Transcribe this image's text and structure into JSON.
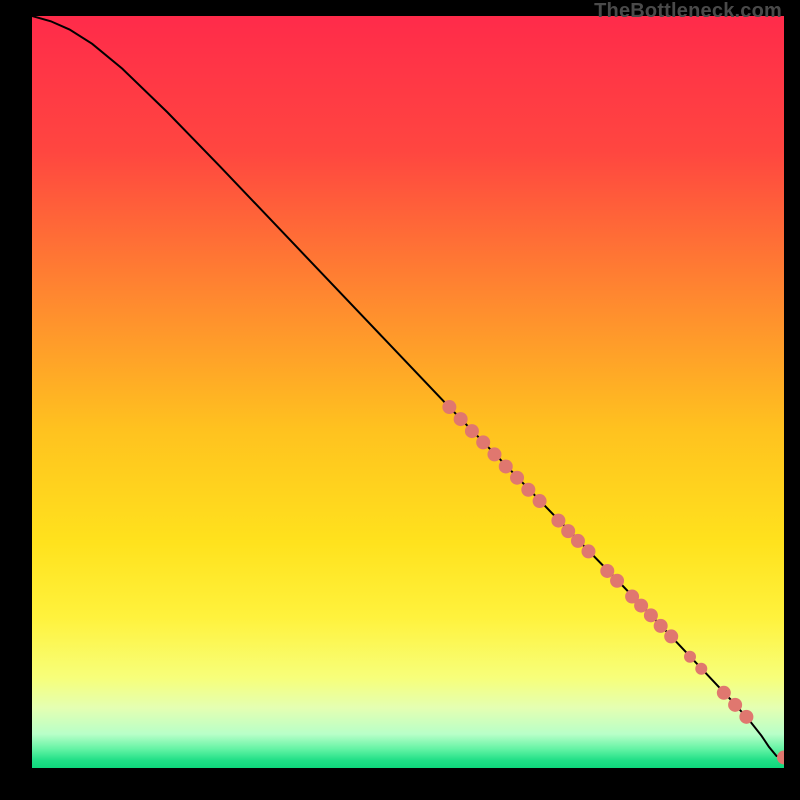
{
  "watermark": "TheBottleneck.com",
  "colors": {
    "dot": "#e0776f",
    "line": "#000000"
  },
  "chart_data": {
    "type": "line",
    "title": "",
    "xlabel": "",
    "ylabel": "",
    "xlim": [
      0,
      100
    ],
    "ylim": [
      0,
      100
    ],
    "grid": false,
    "gradient_stops": [
      {
        "offset": 0.0,
        "color": "#ff2b4a"
      },
      {
        "offset": 0.18,
        "color": "#ff4640"
      },
      {
        "offset": 0.38,
        "color": "#ff8a2f"
      },
      {
        "offset": 0.55,
        "color": "#ffc21f"
      },
      {
        "offset": 0.7,
        "color": "#ffe21d"
      },
      {
        "offset": 0.8,
        "color": "#fff23d"
      },
      {
        "offset": 0.88,
        "color": "#f7ff7a"
      },
      {
        "offset": 0.92,
        "color": "#e4ffb2"
      },
      {
        "offset": 0.955,
        "color": "#b8ffc8"
      },
      {
        "offset": 0.975,
        "color": "#63f3a4"
      },
      {
        "offset": 0.99,
        "color": "#1fdf86"
      },
      {
        "offset": 1.0,
        "color": "#0fd77c"
      }
    ],
    "series": [
      {
        "name": "curve",
        "x": [
          0.0,
          2.5,
          5.0,
          8.0,
          12.0,
          18.0,
          25.0,
          35.0,
          45.0,
          55.0,
          62.0,
          70.0,
          78.0,
          85.0,
          90.0,
          93.0,
          95.5,
          97.0,
          98.0,
          99.0,
          100.0
        ],
        "y": [
          100.0,
          99.3,
          98.2,
          96.3,
          93.0,
          87.2,
          80.0,
          69.5,
          59.0,
          48.5,
          41.3,
          33.0,
          24.8,
          17.5,
          12.2,
          9.0,
          6.2,
          4.3,
          2.8,
          1.6,
          1.4
        ]
      }
    ],
    "points": [
      {
        "x": 55.5,
        "y": 48.0,
        "r": 7
      },
      {
        "x": 57.0,
        "y": 46.4,
        "r": 7
      },
      {
        "x": 58.5,
        "y": 44.8,
        "r": 7
      },
      {
        "x": 60.0,
        "y": 43.3,
        "r": 7
      },
      {
        "x": 61.5,
        "y": 41.7,
        "r": 7
      },
      {
        "x": 63.0,
        "y": 40.1,
        "r": 7
      },
      {
        "x": 64.5,
        "y": 38.6,
        "r": 7
      },
      {
        "x": 66.0,
        "y": 37.0,
        "r": 7
      },
      {
        "x": 67.5,
        "y": 35.5,
        "r": 7
      },
      {
        "x": 70.0,
        "y": 32.9,
        "r": 7
      },
      {
        "x": 71.3,
        "y": 31.5,
        "r": 7
      },
      {
        "x": 72.6,
        "y": 30.2,
        "r": 7
      },
      {
        "x": 74.0,
        "y": 28.8,
        "r": 7
      },
      {
        "x": 76.5,
        "y": 26.2,
        "r": 7
      },
      {
        "x": 77.8,
        "y": 24.9,
        "r": 7
      },
      {
        "x": 79.8,
        "y": 22.8,
        "r": 7
      },
      {
        "x": 81.0,
        "y": 21.6,
        "r": 7
      },
      {
        "x": 82.3,
        "y": 20.3,
        "r": 7
      },
      {
        "x": 83.6,
        "y": 18.9,
        "r": 7
      },
      {
        "x": 85.0,
        "y": 17.5,
        "r": 7
      },
      {
        "x": 87.5,
        "y": 14.8,
        "r": 6
      },
      {
        "x": 89.0,
        "y": 13.2,
        "r": 6
      },
      {
        "x": 92.0,
        "y": 10.0,
        "r": 7
      },
      {
        "x": 93.5,
        "y": 8.4,
        "r": 7
      },
      {
        "x": 95.0,
        "y": 6.8,
        "r": 7
      },
      {
        "x": 100.0,
        "y": 1.4,
        "r": 7
      }
    ]
  }
}
